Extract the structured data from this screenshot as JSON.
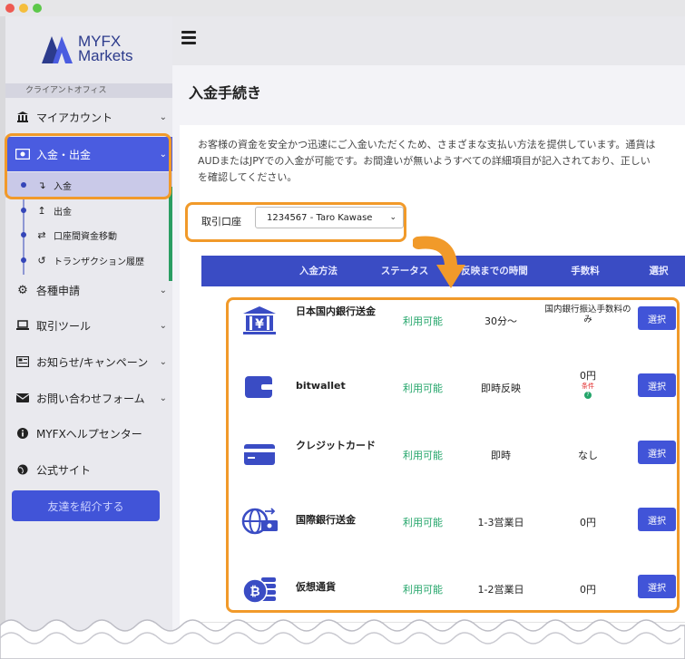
{
  "window": {
    "controls": [
      "close",
      "minimize",
      "zoom"
    ]
  },
  "logo": {
    "line1": "MYFX",
    "line2": "Markets"
  },
  "sidebar": {
    "section_label": "クライアントオフィス",
    "items": [
      {
        "label": "マイアカウント",
        "icon": "bank-icon"
      },
      {
        "label": "入金・出金",
        "icon": "money-icon"
      },
      {
        "label": "各種申請",
        "icon": "gears-icon"
      },
      {
        "label": "取引ツール",
        "icon": "laptop-icon"
      },
      {
        "label": "お知らせ/キャンペーン",
        "icon": "newspaper-icon"
      },
      {
        "label": "お問い合わせフォーム",
        "icon": "envelope-icon"
      },
      {
        "label": "MYFXヘルプセンター",
        "icon": "info-icon"
      },
      {
        "label": "公式サイト",
        "icon": "globe-icon"
      }
    ],
    "subitems": [
      {
        "label": "入金",
        "icon": "arrow-down-icon"
      },
      {
        "label": "出金",
        "icon": "arrow-up-icon"
      },
      {
        "label": "口座間資金移動",
        "icon": "transfer-icon"
      },
      {
        "label": "トランザクション履歴",
        "icon": "history-icon"
      }
    ],
    "refer_button": "友達を紹介する"
  },
  "page": {
    "title": "入金手続き",
    "intro_lines": [
      "お客様の資金を安全かつ迅速にご入金いただくため、さまざまな支払い方法を提供しています。通貨は",
      "AUDまたはJPYでの入金が可能です。お間違いが無いようすべての詳細項目が記入されており、正しい",
      "を確認してください。"
    ],
    "account_label": "取引口座",
    "account_value": "1234567 - Taro Kawase"
  },
  "table": {
    "headers": [
      "入金方法",
      "ステータス",
      "反映までの時間",
      "手数料",
      "選択"
    ],
    "rows": [
      {
        "method": "日本国内銀行送金",
        "status": "利用可能",
        "time": "30分〜",
        "fee": "国内銀行振込手数料のみ",
        "button": "選択",
        "icon": "bank-yen-icon"
      },
      {
        "method": "bitwallet",
        "status": "利用可能",
        "time": "即時反映",
        "fee": "0円",
        "fee_note": "条件",
        "button": "選択",
        "icon": "wallet-icon"
      },
      {
        "method": "クレジットカード",
        "status": "利用可能",
        "time": "即時",
        "fee": "なし",
        "button": "選択",
        "icon": "credit-card-icon"
      },
      {
        "method": "国際銀行送金",
        "status": "利用可能",
        "time": "1-3営業日",
        "fee": "0円",
        "button": "選択",
        "icon": "globe-transfer-icon"
      },
      {
        "method": "仮想通貨",
        "status": "利用可能",
        "time": "1-2営業日",
        "fee": "0円",
        "button": "選択",
        "icon": "bitcoin-icon"
      }
    ]
  },
  "colors": {
    "accent": "#4154d8",
    "highlight": "#f19a2a",
    "status_green": "#23a56a",
    "table_header": "#3a4cc4"
  }
}
